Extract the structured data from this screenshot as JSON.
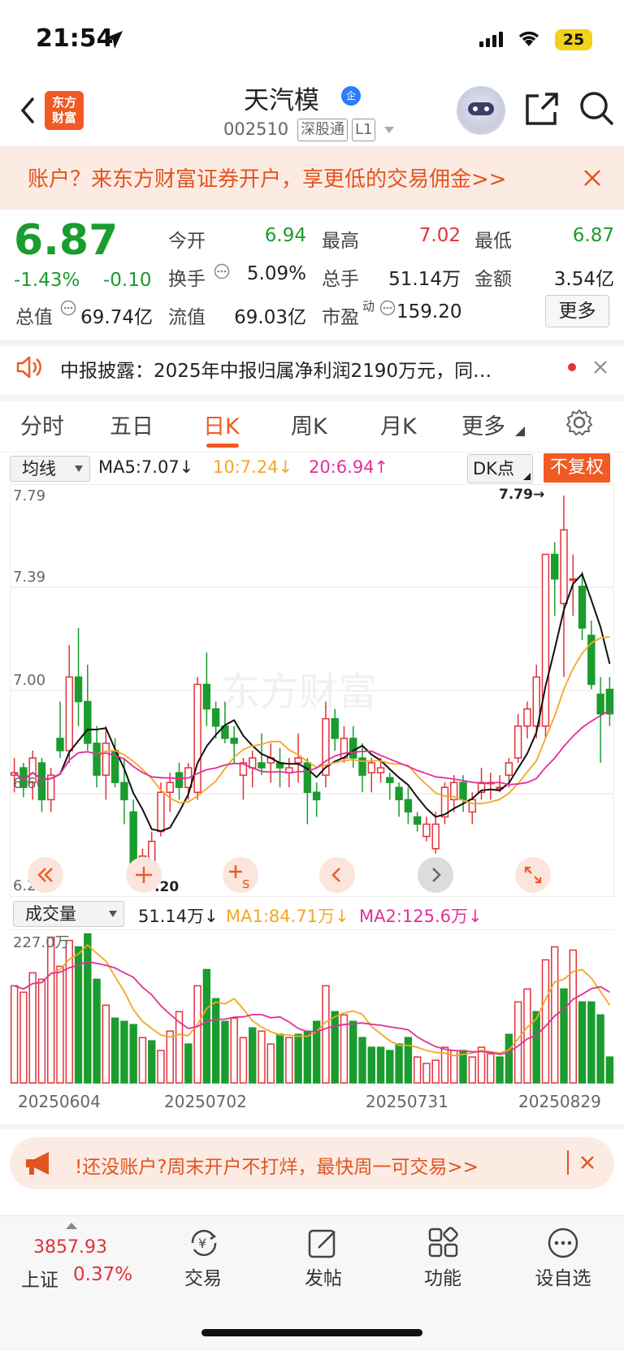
{
  "status_bar": {
    "time": "21:54",
    "battery": "25"
  },
  "header": {
    "logo_text_line1": "东方",
    "logo_text_line2": "财富",
    "stock_name": "天汽模",
    "badge": "企",
    "stock_code": "002510",
    "tag1": "深股通",
    "tag2": "L1"
  },
  "banner": {
    "text": "账户？来东方财富证券开户，享更低的交易佣金>>"
  },
  "quote": {
    "price": "6.87",
    "change_pct": "-1.43%",
    "change_amt": "-0.10",
    "open_label": "今开",
    "open": "6.94",
    "high_label": "最高",
    "high": "7.02",
    "low_label": "最低",
    "low": "6.87",
    "turnover_label": "换手",
    "turnover": "5.09%",
    "volume_label": "总手",
    "volume": "51.14万",
    "amount_label": "金额",
    "amount": "3.54亿",
    "mktcap_label": "总值",
    "mktcap": "69.74亿",
    "float_label": "流值",
    "float": "69.03亿",
    "pe_label": "市盈",
    "pe_sup": "动",
    "pe": "159.20",
    "more": "更多"
  },
  "news": {
    "text": "中报披露：2025年中报归属净利润2190万元，同…"
  },
  "tabs": [
    "分时",
    "五日",
    "日K",
    "周K",
    "月K",
    "更多"
  ],
  "active_tab": 2,
  "kline_header": {
    "indicator_select": "均线",
    "ma5": "MA5:7.07↓",
    "ma10": "10:7.24↓",
    "ma20": "20:6.94↑",
    "dk": "DK点",
    "fuquan": "不复权"
  },
  "kline": {
    "ymax_label": "7.79",
    "y2_label": "7.39",
    "y3_label": "7.00",
    "y4_label": "6.60",
    "ymin_label": "6.20",
    "high_mark": "7.79→",
    "low_mark": "←6.20"
  },
  "volume_header": {
    "select": "成交量",
    "vol": "51.14万↓",
    "ma1": "MA1:84.71万↓",
    "ma2": "MA2:125.6万↓",
    "max_label": "227.0万"
  },
  "dates": [
    "20250604",
    "20250702",
    "20250731",
    "20250829"
  ],
  "ad": {
    "text": "!还没账户?周末开户不打烊，最快周一可交易>>"
  },
  "bottom_nav": {
    "index_value": "3857.93",
    "index_name": "上证",
    "index_change": "0.37%",
    "items": [
      "交易",
      "发帖",
      "功能",
      "设自选"
    ]
  },
  "colors": {
    "up": "#e3323a",
    "down": "#1a9c2e",
    "accent": "#f15a24",
    "ma5": "#111111",
    "ma10": "#f5a623",
    "ma20": "#e0309a"
  },
  "chart_data": {
    "type": "candlestick",
    "ylim": [
      6.2,
      7.79
    ],
    "candles_ohlc": [
      [
        6.65,
        6.72,
        6.58,
        6.66
      ],
      [
        6.68,
        6.7,
        6.56,
        6.6
      ],
      [
        6.62,
        6.75,
        6.55,
        6.72
      ],
      [
        6.7,
        6.72,
        6.5,
        6.55
      ],
      [
        6.55,
        6.68,
        6.5,
        6.65
      ],
      [
        6.8,
        6.95,
        6.72,
        6.75
      ],
      [
        6.75,
        7.18,
        6.7,
        7.05
      ],
      [
        7.05,
        7.25,
        6.85,
        6.95
      ],
      [
        6.95,
        7.1,
        6.75,
        6.78
      ],
      [
        6.78,
        6.85,
        6.6,
        6.65
      ],
      [
        6.65,
        6.85,
        6.55,
        6.78
      ],
      [
        6.75,
        6.8,
        6.6,
        6.62
      ],
      [
        6.62,
        6.72,
        6.45,
        6.55
      ],
      [
        6.5,
        6.55,
        6.25,
        6.28
      ],
      [
        6.28,
        6.35,
        6.22,
        6.32
      ],
      [
        6.25,
        6.42,
        6.2,
        6.38
      ],
      [
        6.42,
        6.62,
        6.4,
        6.58
      ],
      [
        6.58,
        6.66,
        6.5,
        6.62
      ],
      [
        6.66,
        6.7,
        6.55,
        6.6
      ],
      [
        6.6,
        6.7,
        6.55,
        6.68
      ],
      [
        6.58,
        7.05,
        6.55,
        7.02
      ],
      [
        7.02,
        7.15,
        6.85,
        6.92
      ],
      [
        6.92,
        6.95,
        6.8,
        6.85
      ],
      [
        6.85,
        6.95,
        6.78,
        6.8
      ],
      [
        6.8,
        6.85,
        6.7,
        6.78
      ],
      [
        6.65,
        6.72,
        6.55,
        6.7
      ],
      [
        6.68,
        6.75,
        6.6,
        6.72
      ],
      [
        6.7,
        6.82,
        6.65,
        6.68
      ],
      [
        6.7,
        6.78,
        6.62,
        6.72
      ],
      [
        6.7,
        6.76,
        6.6,
        6.68
      ],
      [
        6.66,
        6.72,
        6.6,
        6.68
      ],
      [
        6.7,
        6.82,
        6.62,
        6.72
      ],
      [
        6.7,
        6.72,
        6.45,
        6.58
      ],
      [
        6.58,
        6.62,
        6.48,
        6.55
      ],
      [
        6.65,
        6.95,
        6.6,
        6.88
      ],
      [
        6.88,
        6.92,
        6.75,
        6.8
      ],
      [
        6.72,
        6.85,
        6.7,
        6.8
      ],
      [
        6.8,
        6.85,
        6.68,
        6.72
      ],
      [
        6.72,
        6.78,
        6.58,
        6.65
      ],
      [
        6.66,
        6.72,
        6.58,
        6.7
      ],
      [
        6.66,
        6.72,
        6.62,
        6.68
      ],
      [
        6.64,
        6.66,
        6.55,
        6.62
      ],
      [
        6.6,
        6.62,
        6.48,
        6.55
      ],
      [
        6.55,
        6.6,
        6.45,
        6.5
      ],
      [
        6.48,
        6.5,
        6.42,
        6.45
      ],
      [
        6.4,
        6.48,
        6.38,
        6.45
      ],
      [
        6.35,
        6.5,
        6.33,
        6.45
      ],
      [
        6.48,
        6.62,
        6.45,
        6.6
      ],
      [
        6.55,
        6.65,
        6.5,
        6.62
      ],
      [
        6.62,
        6.65,
        6.5,
        6.55
      ],
      [
        6.5,
        6.58,
        6.45,
        6.55
      ],
      [
        6.58,
        6.68,
        6.55,
        6.62
      ],
      [
        6.62,
        6.66,
        6.55,
        6.62
      ],
      [
        6.6,
        6.65,
        6.58,
        6.6
      ],
      [
        6.65,
        6.72,
        6.6,
        6.7
      ],
      [
        6.72,
        6.9,
        6.7,
        6.85
      ],
      [
        6.85,
        6.95,
        6.8,
        6.92
      ],
      [
        6.85,
        7.1,
        6.8,
        7.05
      ],
      [
        6.85,
        7.55,
        6.8,
        7.55
      ],
      [
        7.55,
        7.6,
        7.3,
        7.45
      ],
      [
        7.35,
        7.79,
        7.05,
        7.65
      ],
      [
        7.45,
        7.55,
        7.3,
        7.45
      ],
      [
        7.42,
        7.48,
        7.2,
        7.25
      ],
      [
        7.22,
        7.28,
        7.0,
        7.02
      ],
      [
        6.98,
        7.05,
        6.7,
        6.9
      ],
      [
        7.0,
        7.05,
        6.85,
        6.9
      ]
    ],
    "volume": [
      [
        150,
        1
      ],
      [
        140,
        1
      ],
      [
        170,
        1
      ],
      [
        160,
        1
      ],
      [
        225,
        1
      ],
      [
        180,
        1
      ],
      [
        220,
        1
      ],
      [
        210,
        0
      ],
      [
        230,
        0
      ],
      [
        160,
        0
      ],
      [
        120,
        1
      ],
      [
        100,
        0
      ],
      [
        95,
        0
      ],
      [
        90,
        0
      ],
      [
        70,
        1
      ],
      [
        65,
        0
      ],
      [
        50,
        1
      ],
      [
        80,
        1
      ],
      [
        110,
        1
      ],
      [
        60,
        0
      ],
      [
        150,
        1
      ],
      [
        175,
        0
      ],
      [
        130,
        0
      ],
      [
        95,
        0
      ],
      [
        100,
        1
      ],
      [
        70,
        1
      ],
      [
        85,
        0
      ],
      [
        80,
        1
      ],
      [
        60,
        1
      ],
      [
        75,
        0
      ],
      [
        70,
        1
      ],
      [
        75,
        0
      ],
      [
        80,
        0
      ],
      [
        95,
        0
      ],
      [
        150,
        1
      ],
      [
        110,
        0
      ],
      [
        105,
        1
      ],
      [
        95,
        0
      ],
      [
        70,
        0
      ],
      [
        55,
        0
      ],
      [
        55,
        0
      ],
      [
        50,
        0
      ],
      [
        60,
        0
      ],
      [
        70,
        0
      ],
      [
        40,
        1
      ],
      [
        30,
        1
      ],
      [
        35,
        1
      ],
      [
        55,
        1
      ],
      [
        50,
        1
      ],
      [
        50,
        0
      ],
      [
        40,
        1
      ],
      [
        55,
        1
      ],
      [
        45,
        1
      ],
      [
        40,
        0
      ],
      [
        75,
        0
      ],
      [
        125,
        1
      ],
      [
        145,
        1
      ],
      [
        110,
        0
      ],
      [
        190,
        1
      ],
      [
        210,
        1
      ],
      [
        145,
        0
      ],
      [
        205,
        1
      ],
      [
        125,
        0
      ],
      [
        125,
        0
      ],
      [
        105,
        0
      ],
      [
        40,
        0
      ]
    ],
    "x_labels": [
      "20250604",
      "20250702",
      "20250731",
      "20250829"
    ]
  }
}
